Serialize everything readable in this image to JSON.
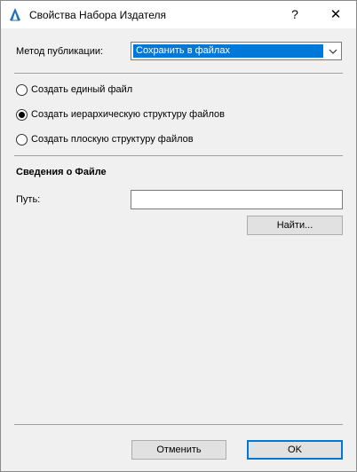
{
  "window": {
    "title": "Свойства Набора Издателя"
  },
  "titlebar": {
    "help_label": "?",
    "close_label": "✕"
  },
  "publish_method": {
    "label": "Метод публикации:",
    "selected": "Сохранить в файлах"
  },
  "options": [
    {
      "label": "Создать единый файл",
      "selected": false
    },
    {
      "label": "Создать иерархическую структуру файлов",
      "selected": true
    },
    {
      "label": "Создать плоскую структуру файлов",
      "selected": false
    }
  ],
  "file_info": {
    "title": "Сведения о Файле",
    "path_label": "Путь:",
    "path_value": "",
    "browse_label": "Найти..."
  },
  "footer": {
    "cancel_label": "Отменить",
    "ok_label": "OK"
  },
  "colors": {
    "accent": "#0078d7",
    "background": "#f0f0f0"
  },
  "icons": {
    "app": "archicad-icon",
    "dropdown": "chevron-down-icon"
  }
}
